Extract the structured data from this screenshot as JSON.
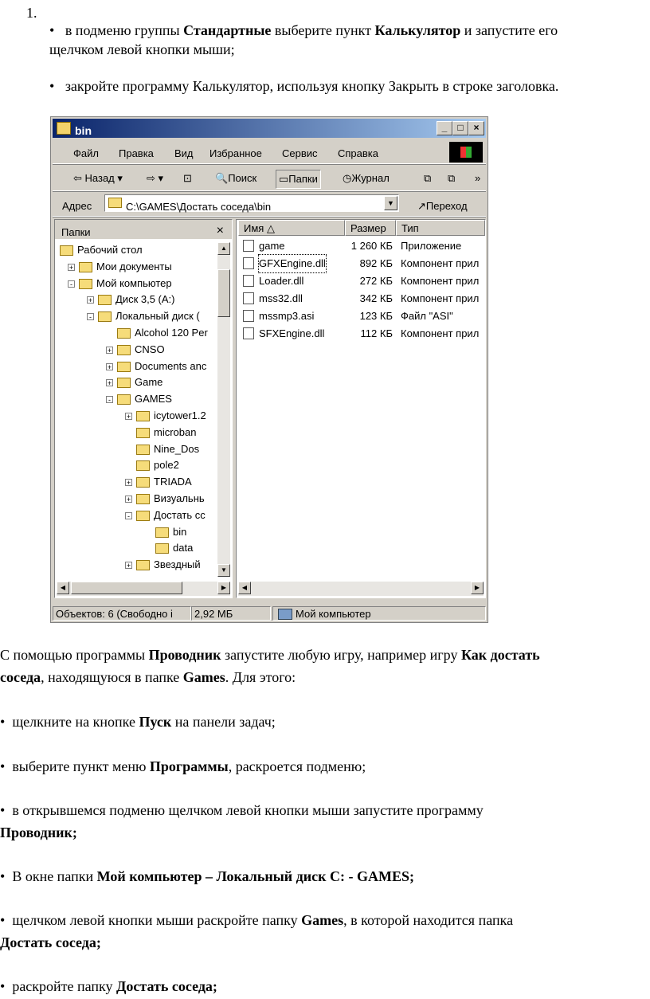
{
  "list_number": "1.",
  "bullet": "•",
  "intro_bullets": [
    {
      "a": "в подменю группы ",
      "b1": "Стандартные",
      "c": " выберите пункт ",
      "b2": "Калькулятор",
      "d": " и запустите его",
      "line2": "щелчком левой кнопки мыши;"
    },
    {
      "text": "закройте программу Калькулятор, используя кнопку Закрыть в строке заголовка."
    }
  ],
  "window": {
    "title": "bin",
    "btn_min": "_",
    "btn_max": "□",
    "btn_close": "×",
    "menu": [
      "Файл",
      "Правка",
      "Вид",
      "Избранное",
      "Сервис",
      "Справка"
    ],
    "toolbar": {
      "back": "Назад",
      "search": "Поиск",
      "folders": "Папки",
      "journal": "Журнал",
      "more": "»"
    },
    "address": {
      "label": "Адрес",
      "value": "C:\\GAMES\\Достать соседа\\bin",
      "go": "Переход"
    },
    "folders_pane": {
      "title": "Папки",
      "close": "×",
      "items": [
        {
          "label": "Рабочий стол",
          "level": 0,
          "pm": ""
        },
        {
          "label": "Мои документы",
          "level": 1,
          "pm": "+"
        },
        {
          "label": "Мой компьютер",
          "level": 1,
          "pm": "-"
        },
        {
          "label": "Диск 3,5 (A:)",
          "level": 2,
          "pm": "+"
        },
        {
          "label": "Локальный диск (",
          "level": 2,
          "pm": "-"
        },
        {
          "label": "Alcohol 120 Per",
          "level": 3,
          "pm": ""
        },
        {
          "label": "CNSO",
          "level": 3,
          "pm": "+"
        },
        {
          "label": "Documents anc",
          "level": 3,
          "pm": "+"
        },
        {
          "label": "Game",
          "level": 3,
          "pm": "+"
        },
        {
          "label": "GAMES",
          "level": 3,
          "pm": "-"
        },
        {
          "label": "icytower1.2",
          "level": 4,
          "pm": "+"
        },
        {
          "label": "microban",
          "level": 4,
          "pm": ""
        },
        {
          "label": "Nine_Dos",
          "level": 4,
          "pm": ""
        },
        {
          "label": "pole2",
          "level": 4,
          "pm": ""
        },
        {
          "label": "TRIADA",
          "level": 4,
          "pm": "+"
        },
        {
          "label": "Визуальнь",
          "level": 4,
          "pm": "+"
        },
        {
          "label": "Достать сс",
          "level": 4,
          "pm": "-"
        },
        {
          "label": "bin",
          "level": 5,
          "pm": ""
        },
        {
          "label": "data",
          "level": 5,
          "pm": ""
        },
        {
          "label": "Звездный",
          "level": 4,
          "pm": "+"
        }
      ]
    },
    "columns": {
      "name": "Имя",
      "size": "Размер",
      "type": "Тип"
    },
    "files": [
      {
        "name": "game",
        "size": "1 260 КБ",
        "type": "Приложение"
      },
      {
        "name": "GFXEngine.dll",
        "size": "892 КБ",
        "type": "Компонент прил"
      },
      {
        "name": "Loader.dll",
        "size": "272 КБ",
        "type": "Компонент прил"
      },
      {
        "name": "mss32.dll",
        "size": "342 КБ",
        "type": "Компонент прил"
      },
      {
        "name": "mssmp3.asi",
        "size": "123 КБ",
        "type": "Файл \"ASI\""
      },
      {
        "name": "SFXEngine.dll",
        "size": "112 КБ",
        "type": "Компонент прил"
      }
    ],
    "status": {
      "objects": "Объектов: 6 (Свободно і",
      "size": "2,92 МБ",
      "location": "Мой компьютер"
    }
  },
  "body": {
    "p1": {
      "a": "С помощью программы ",
      "b1": "Проводник",
      "c": " запустите любую игру, например игру ",
      "b2": "Как достать",
      "b3": "соседа",
      "d": ", находящуюся в папке ",
      "b4": "Games",
      "e": ". Для этого:"
    },
    "s1": {
      "a": "щелкните на кнопке ",
      "b": "Пуск",
      "c": " на панели задач;"
    },
    "s2": {
      "a": "выберите пункт меню ",
      "b": "Программы",
      "c": ", раскроется подменю;"
    },
    "s3": {
      "a": "в открывшемся подменю щелчком левой кнопки мыши запустите программу",
      "b": "Проводник;"
    },
    "s4": {
      "a": "В окне папки ",
      "b": "Мой компьютер – Локальный диск С: - GAMES;"
    },
    "s5": {
      "a": "щелчком левой кнопки мыши раскройте папку ",
      "b1": "Games",
      "c": ", в которой находится папка",
      "b2": "Достать соседа;"
    },
    "s6": {
      "a": "раскройте папку ",
      "b": "Достать соседа;"
    }
  }
}
